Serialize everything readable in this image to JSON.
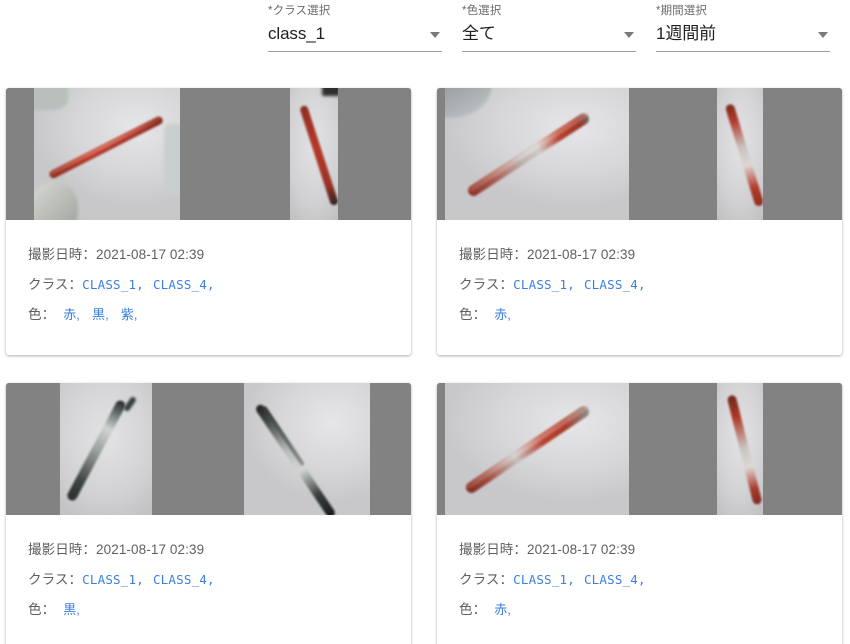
{
  "filters": [
    {
      "label": "*クラス選択",
      "value": "class_1",
      "icon": "chevron-down-icon",
      "name": "class-select"
    },
    {
      "label": "*色選択",
      "value": "全て",
      "icon": "chevron-down-icon",
      "name": "color-select"
    },
    {
      "label": "*期間選択",
      "value": "1週間前",
      "icon": "chevron-down-icon",
      "name": "period-select"
    }
  ],
  "labels": {
    "datetime_label": "撮影日時：",
    "class_label": "クラス：",
    "color_label": "色：",
    "link_color": "#3b7fe0",
    "text_color": "#5f5f5f",
    "thumb_pad_color": "#828282"
  },
  "cards": [
    {
      "datetime": "2021-08-17 02:39",
      "classes": [
        "CLASS_1,",
        "CLASS_4,"
      ],
      "colors": [
        "赤,",
        "黒,",
        "紫,"
      ]
    },
    {
      "datetime": "2021-08-17 02:39",
      "classes": [
        "CLASS_1,",
        "CLASS_4,"
      ],
      "colors": [
        "赤,"
      ]
    },
    {
      "datetime": "2021-08-17 02:39",
      "classes": [
        "CLASS_1,",
        "CLASS_4,"
      ],
      "colors": [
        "黒,"
      ]
    },
    {
      "datetime": "2021-08-17 02:39",
      "classes": [
        "CLASS_1,",
        "CLASS_4,"
      ],
      "colors": [
        "赤,"
      ]
    }
  ]
}
